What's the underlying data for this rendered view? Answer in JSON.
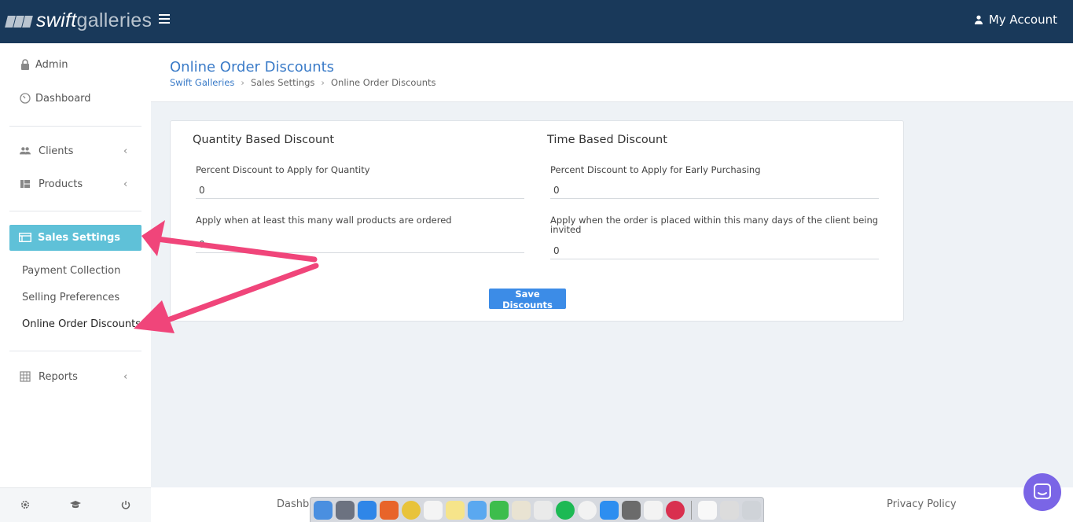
{
  "brand": {
    "name_bold": "swift",
    "name_light": "galleries"
  },
  "header": {
    "account_label": "My Account"
  },
  "sidebar": {
    "items": [
      {
        "label": "Admin"
      },
      {
        "label": "Dashboard"
      },
      {
        "label": "Clients"
      },
      {
        "label": "Products"
      },
      {
        "label": "Sales Settings"
      },
      {
        "label": "Reports"
      }
    ],
    "sub_items": [
      {
        "label": "Payment Collection"
      },
      {
        "label": "Selling Preferences"
      },
      {
        "label": "Online Order Discounts"
      }
    ]
  },
  "page": {
    "title": "Online Order Discounts",
    "breadcrumb": [
      "Swift Galleries",
      "Sales Settings",
      "Online Order Discounts"
    ]
  },
  "quantity": {
    "title": "Quantity Based Discount",
    "percent_label": "Percent Discount to Apply for Quantity",
    "percent_value": "0",
    "count_label": "Apply when at least this many wall products are ordered",
    "count_value": "0"
  },
  "time": {
    "title": "Time Based Discount",
    "percent_label": "Percent Discount to Apply for Early Purchasing",
    "percent_value": "0",
    "days_label": "Apply when the order is placed within this many days of the client being invited",
    "days_value": "0"
  },
  "save_label": "Save Discounts",
  "footer": {
    "dashboard_partial": "Dashb",
    "privacy": "Privacy Policy"
  },
  "colors": {
    "topbar": "#19395a",
    "accent": "#5fc1d8",
    "link": "#3a7bc8",
    "button": "#3c8ce7",
    "arrow": "#f0457a",
    "chat": "#7a65e6"
  }
}
